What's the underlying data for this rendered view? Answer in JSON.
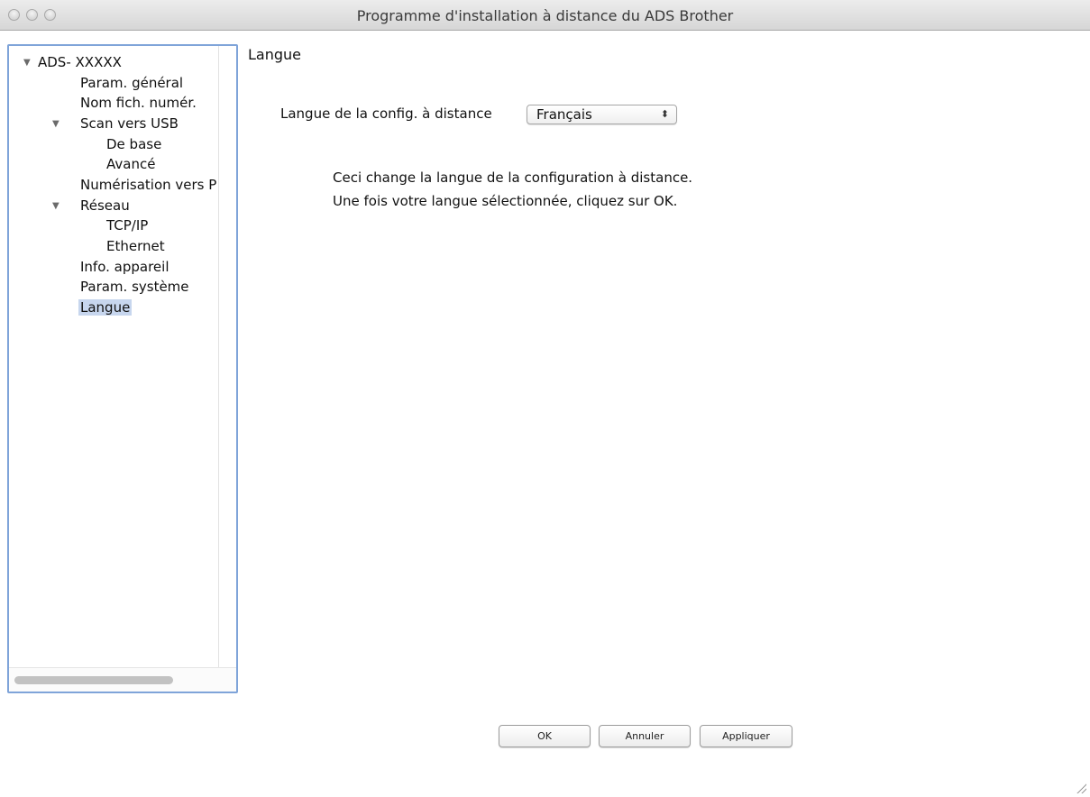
{
  "window": {
    "title": "Programme d'installation à distance du ADS Brother"
  },
  "sidebar": {
    "items": [
      {
        "label": "ADS- XXXXX",
        "expanded": true
      },
      {
        "label": "Param. général"
      },
      {
        "label": "Nom fich. numér."
      },
      {
        "label": "Scan vers USB",
        "expanded": true
      },
      {
        "label": "De base"
      },
      {
        "label": "Avancé"
      },
      {
        "label": "Numérisation vers P"
      },
      {
        "label": "Réseau",
        "expanded": true
      },
      {
        "label": "TCP/IP"
      },
      {
        "label": "Ethernet"
      },
      {
        "label": "Info. appareil"
      },
      {
        "label": "Param. système"
      },
      {
        "label": "Langue",
        "selected": true
      }
    ]
  },
  "main": {
    "title": "Langue",
    "setting_label": "Langue de la config. à distance",
    "language_select": {
      "value": "Français"
    },
    "description_line1": "Ceci change la langue de la configuration à distance.",
    "description_line2": "Une fois votre langue sélectionnée, cliquez sur OK."
  },
  "buttons": {
    "ok": "OK",
    "cancel": "Annuler",
    "apply": "Appliquer"
  },
  "icons": {
    "expand": "disclosure-triangle-icon",
    "select_arrows": "up-down-arrows-icon",
    "resize": "resize-grip-icon"
  },
  "colors": {
    "selection": "#c7d6ee",
    "focus_border": "#7fa4d9"
  }
}
